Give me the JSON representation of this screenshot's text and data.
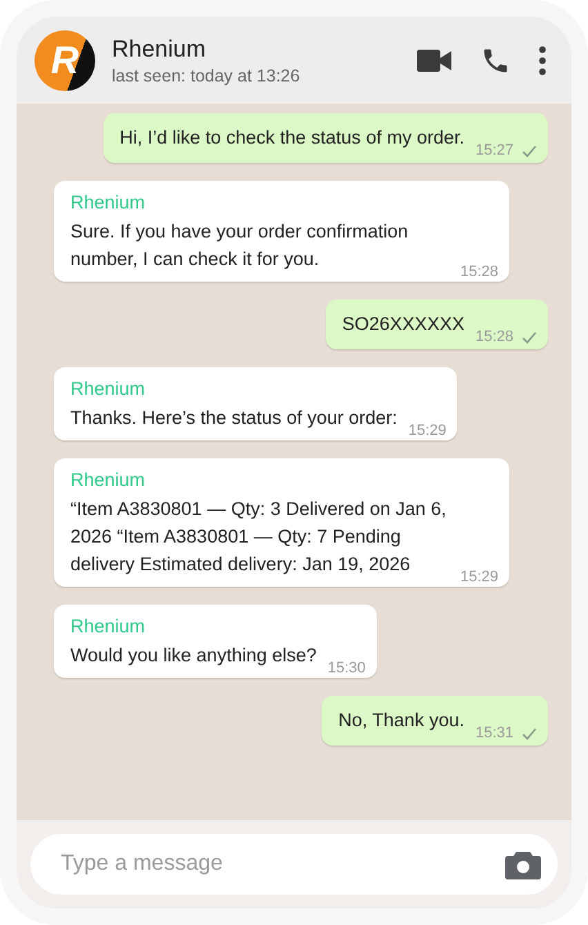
{
  "header": {
    "avatar_letter": "R",
    "name": "Rhenium",
    "status": "last seen: today at 13:26"
  },
  "messages": [
    {
      "kind": "sent",
      "text": "Hi, I’d like to check the status of my order.",
      "time": "15:27"
    },
    {
      "kind": "received",
      "sender": "Rhenium",
      "text": "Sure. If you have your order confirmation number, I can check it for you.",
      "time": "15:28"
    },
    {
      "kind": "sent",
      "text": "SO26XXXXXX",
      "time": "15:28"
    },
    {
      "kind": "received",
      "sender": "Rhenium",
      "text": "Thanks. Here’s the status of your order:",
      "time": "15:29"
    },
    {
      "kind": "received",
      "sender": "Rhenium",
      "text": "“Item A3830801 — Qty: 3 Delivered on Jan 6, 2026 “Item A3830801 — Qty: 7 Pending delivery Estimated delivery: Jan 19, 2026",
      "time": "15:29"
    },
    {
      "kind": "received",
      "sender": "Rhenium",
      "text": "Would you like anything else?",
      "time": "15:30"
    },
    {
      "kind": "sent",
      "text": "No, Thank you.",
      "time": "15:31"
    }
  ],
  "composer": {
    "placeholder": "Type a message"
  }
}
